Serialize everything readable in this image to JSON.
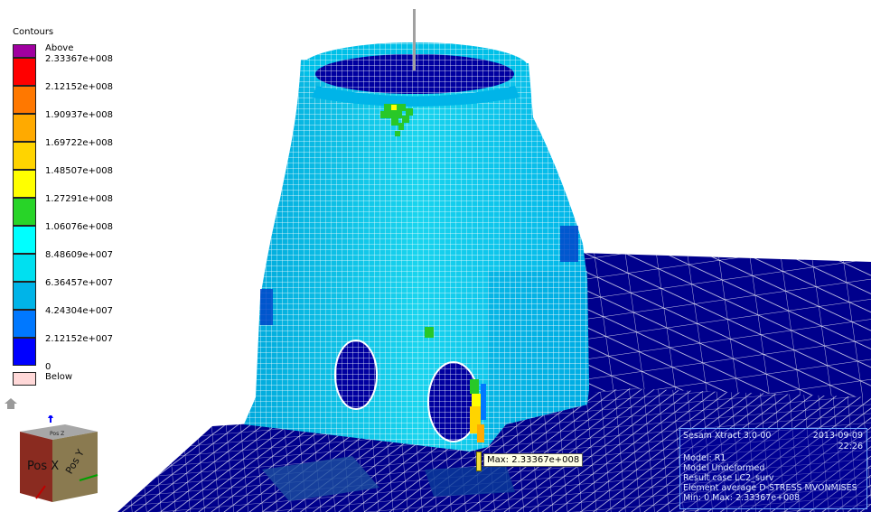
{
  "legend": {
    "title": "Contours",
    "entries": [
      {
        "label": "Above",
        "color": "#a000a0"
      },
      {
        "label": "2.33367e+008",
        "color": "#ff0000"
      },
      {
        "label": "2.12152e+008",
        "color": "#ff7800"
      },
      {
        "label": "1.90937e+008",
        "color": "#ffaa00"
      },
      {
        "label": "1.69722e+008",
        "color": "#ffd400"
      },
      {
        "label": "1.48507e+008",
        "color": "#ffff00"
      },
      {
        "label": "1.27291e+008",
        "color": "#28d428"
      },
      {
        "label": "1.06076e+008",
        "color": "#00ffff"
      },
      {
        "label": "8.48609e+007",
        "color": "#00e0f0"
      },
      {
        "label": "6.36457e+007",
        "color": "#00b4e8"
      },
      {
        "label": "4.24304e+007",
        "color": "#0078ff"
      },
      {
        "label": "2.12152e+007",
        "color": "#0000ff"
      },
      {
        "label": "0",
        "color": ""
      },
      {
        "label": "Below",
        "color": "#ffd8d8"
      }
    ]
  },
  "view_cube": {
    "front_label": "Pos X",
    "side_label": "Pos Y",
    "top_label": "Pos Z",
    "icons": [
      "home-icon",
      "view-cube"
    ]
  },
  "max_annotation": {
    "label": "Max: 2.33367e+008"
  },
  "info_panel": {
    "program": "Sesam Xtract 3.0-00",
    "date": "2013-09-09",
    "time": "22:26",
    "model": "Model: R1",
    "state": "Model Undeformed",
    "result_case": "Result case LC2_surv",
    "quantity": "Element average D-STRESS MVONMISES",
    "range": "Min: 0 Max: 2.33367e+008"
  },
  "colors": {
    "mesh_line": "#ffffff",
    "deck": "#00008c",
    "stress_base": "#00c8e6"
  }
}
